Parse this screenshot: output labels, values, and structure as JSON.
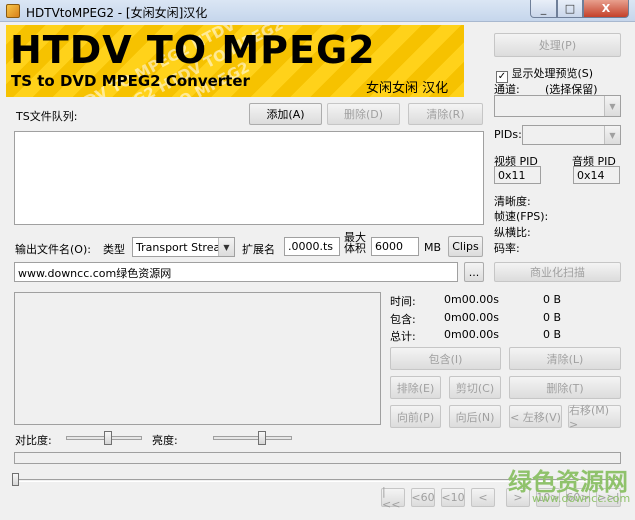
{
  "window": {
    "title": "HDTVtoMPEG2 - [女闲女闲]汉化",
    "min_icon": "_",
    "max_icon": "□",
    "close_icon": "X"
  },
  "banner": {
    "title": "HTDV TO MPEG2",
    "subtitle": "TS to DVD MPEG2 Converter",
    "localizer": "女闲女闲 汉化",
    "watermark": "HTDV TO MPEG2 HTDV TO MPEG2"
  },
  "queue": {
    "label": "TS文件队列:",
    "add": "添加(A)",
    "delete": "删除(D)",
    "clear": "清除(R)"
  },
  "right": {
    "process": "处理(P)",
    "show_preview": "显示处理预览(S)",
    "preview_checked": true,
    "channel_label": "通道:",
    "channel_hint": "(选择保留)",
    "pids_label": "PIDs:",
    "video_pid_label": "视频 PID",
    "video_pid": "0x11",
    "audio_pid_label": "音频 PID",
    "audio_pid": "0x14",
    "clarity": "清晰度:",
    "framerate": "帧速(FPS):",
    "aspect": "纵横比:",
    "bitrate": "码率:",
    "scan": "商业化扫描"
  },
  "output": {
    "label": "输出文件名(O):",
    "type_label": "类型",
    "type_value": "Transport Stream",
    "ext_label": "扩展名",
    "ext_value": ".0000.ts",
    "maxsize_label1": "最大",
    "maxsize_label2": "体积",
    "maxsize_value": "6000",
    "unit": "MB",
    "clips": "Clips",
    "path_value": "www.downcc.com绿色资源网",
    "browse": "..."
  },
  "stats": {
    "time_label": "时间:",
    "time_value": "0m00.00s",
    "time_size": "0 B",
    "include_label": "包含:",
    "include_value": "0m00.00s",
    "include_size": "0 B",
    "total_label": "总计:",
    "total_value": "0m00.00s",
    "total_size": "0 B"
  },
  "edit": {
    "include": "包含(I)",
    "clear": "清除(L)",
    "exclude": "排除(E)",
    "cut": "剪切(C)",
    "delete": "删除(T)",
    "forward": "向前(P)",
    "backward": "向后(N)",
    "left": "< 左移(V)",
    "right": "右移(M) >"
  },
  "sliders": {
    "contrast": "对比度:",
    "contrast_level": 0.55,
    "brightness": "亮度:",
    "brightness_level": 0.62
  },
  "nav": {
    "first": "|<<",
    "back60": "<60",
    "back10": "<10",
    "back1": "<",
    "fwd1": ">",
    "fwd10": "10>",
    "fwd60": "60>",
    "last": ">>|"
  },
  "watermark": {
    "brand": "绿色资源网",
    "url": "www.downcc.com"
  },
  "colors": {
    "banner_yellow": "#ffd21a",
    "watermark_green": "#8fc26b"
  }
}
